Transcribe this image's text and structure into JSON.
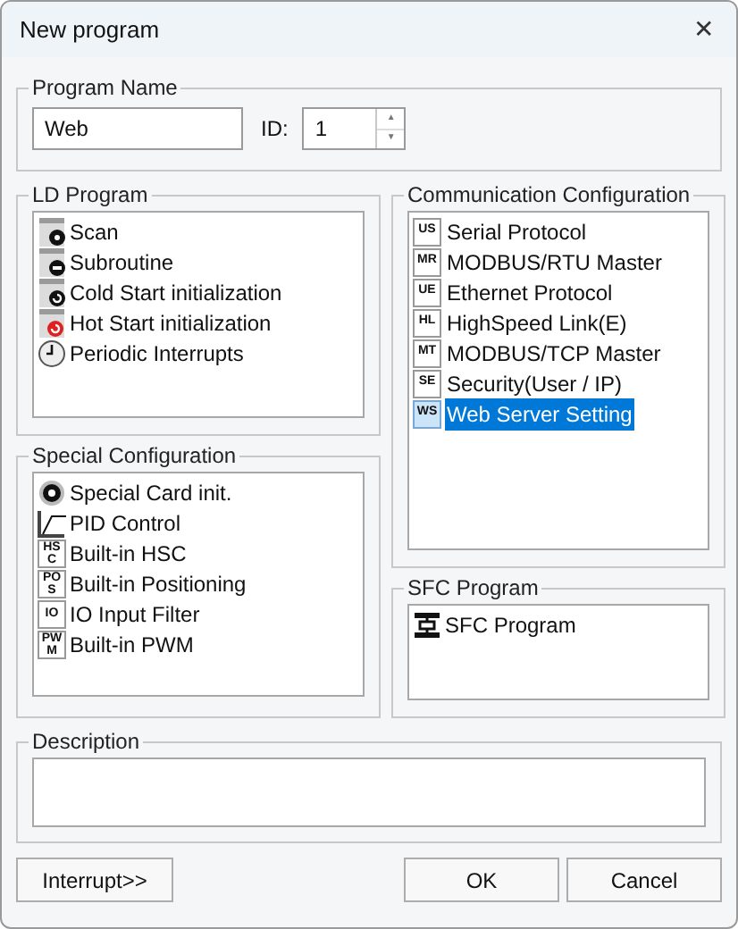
{
  "window": {
    "title": "New program",
    "close": "✕"
  },
  "program_name": {
    "legend": "Program Name",
    "name_value": "Web",
    "id_label": "ID:",
    "id_value": "1",
    "up": "▲",
    "down": "▼"
  },
  "ld_program": {
    "legend": "LD Program",
    "items": [
      {
        "label": "Scan",
        "kind": "scan"
      },
      {
        "label": "Subroutine",
        "kind": "subroutine"
      },
      {
        "label": "Cold Start initialization",
        "kind": "cold"
      },
      {
        "label": "Hot Start initialization",
        "kind": "hot"
      },
      {
        "label": "Periodic Interrupts",
        "kind": "clock"
      }
    ]
  },
  "communication": {
    "legend": "Communication Configuration",
    "items": [
      {
        "label": "Serial Protocol",
        "badge": "US",
        "selected": false
      },
      {
        "label": "MODBUS/RTU Master",
        "badge": "MR",
        "selected": false
      },
      {
        "label": "Ethernet Protocol",
        "badge": "UE",
        "selected": false
      },
      {
        "label": "HighSpeed Link(E)",
        "badge": "HL",
        "selected": false
      },
      {
        "label": "MODBUS/TCP Master",
        "badge": "MT",
        "selected": false
      },
      {
        "label": "Security(User / IP)",
        "badge": "SE",
        "selected": false
      },
      {
        "label": "Web Server Setting",
        "badge": "WS",
        "selected": true
      }
    ]
  },
  "special": {
    "legend": "Special Configuration",
    "items": [
      {
        "label": "Special Card init.",
        "kind": "card"
      },
      {
        "label": "PID Control",
        "kind": "pid"
      },
      {
        "label": "Built-in HSC",
        "kind": "badge",
        "badge_top": "HS",
        "badge_bottom": "C"
      },
      {
        "label": "Built-in Positioning",
        "kind": "badge",
        "badge_top": "PO",
        "badge_bottom": "S"
      },
      {
        "label": "IO Input Filter",
        "kind": "badge",
        "badge_top": "IO"
      },
      {
        "label": "Built-in PWM",
        "kind": "badge",
        "badge_top": "PW",
        "badge_bottom": "M"
      }
    ]
  },
  "sfc_program": {
    "legend": "SFC Program",
    "items": [
      {
        "label": "SFC Program",
        "kind": "sfc"
      }
    ]
  },
  "description": {
    "legend": "Description"
  },
  "buttons": [
    {
      "label": "Interrupt>>",
      "kind": "left"
    },
    {
      "label": "OK",
      "kind": "default"
    },
    {
      "label": "Cancel",
      "kind": "normal"
    }
  ]
}
